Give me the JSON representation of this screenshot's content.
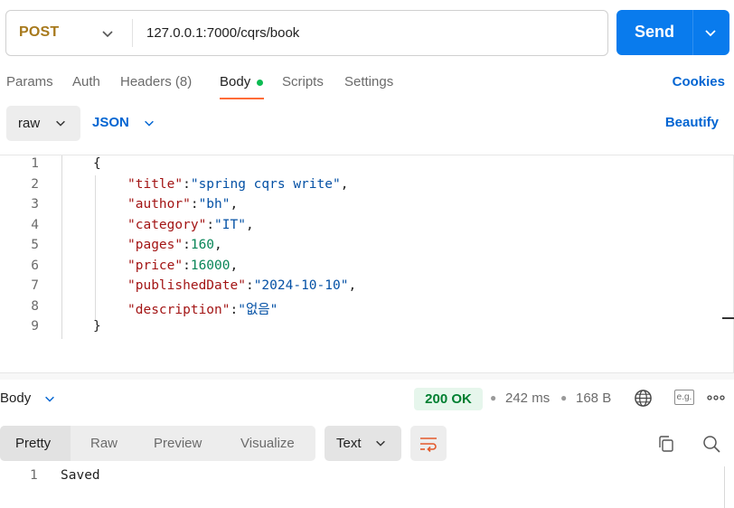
{
  "request": {
    "method": "POST",
    "url": "127.0.0.1:7000/cqrs/book",
    "send_label": "Send"
  },
  "tabs": [
    {
      "label": "Params"
    },
    {
      "label": "Auth"
    },
    {
      "label": "Headers (8)"
    },
    {
      "label": "Body"
    },
    {
      "label": "Scripts"
    },
    {
      "label": "Settings"
    }
  ],
  "active_tab": "Body",
  "cookies_label": "Cookies",
  "body_options": {
    "mode": "raw",
    "language": "JSON",
    "beautify_label": "Beautify"
  },
  "editor": {
    "line_numbers": [
      "1",
      "2",
      "3",
      "4",
      "5",
      "6",
      "7",
      "8",
      "9"
    ],
    "open_brace": "{",
    "close_brace": "}",
    "fields": [
      {
        "key": "\"title\"",
        "value": "\"spring cqrs write\"",
        "type": "string",
        "trail": ","
      },
      {
        "key": "\"author\"",
        "value": "\"bh\"",
        "type": "string",
        "trail": ","
      },
      {
        "key": "\"category\"",
        "value": "\"IT\"",
        "type": "string",
        "trail": ","
      },
      {
        "key": "\"pages\"",
        "value": "160",
        "type": "number",
        "trail": ","
      },
      {
        "key": "\"price\"",
        "value": "16000",
        "type": "number",
        "trail": ","
      },
      {
        "key": "\"publishedDate\"",
        "value": "\"2024-10-10\"",
        "type": "string",
        "trail": ","
      },
      {
        "key": "\"description\"",
        "value": "\"없음\"",
        "type": "string",
        "trail": ""
      }
    ]
  },
  "response": {
    "section_label": "Body",
    "status": "200 OK",
    "time": "242 ms",
    "size": "168 B",
    "eg_label": "e.g.",
    "view_tabs": [
      "Pretty",
      "Raw",
      "Preview",
      "Visualize"
    ],
    "active_view": "Pretty",
    "format": "Text",
    "lines": [
      {
        "num": "1",
        "text": "Saved"
      }
    ]
  },
  "colors": {
    "method": "#a7791c",
    "send": "#097bed",
    "link": "#0265d2",
    "status_bg": "#e6f6ec",
    "status_text": "#007f31",
    "active_tab_underline": "#ff6c37",
    "body_dot": "#0cbb52"
  },
  "icons": [
    "chevron-down-icon",
    "globe-icon",
    "more-icon",
    "wrap-lines-icon",
    "copy-icon",
    "search-icon"
  ]
}
